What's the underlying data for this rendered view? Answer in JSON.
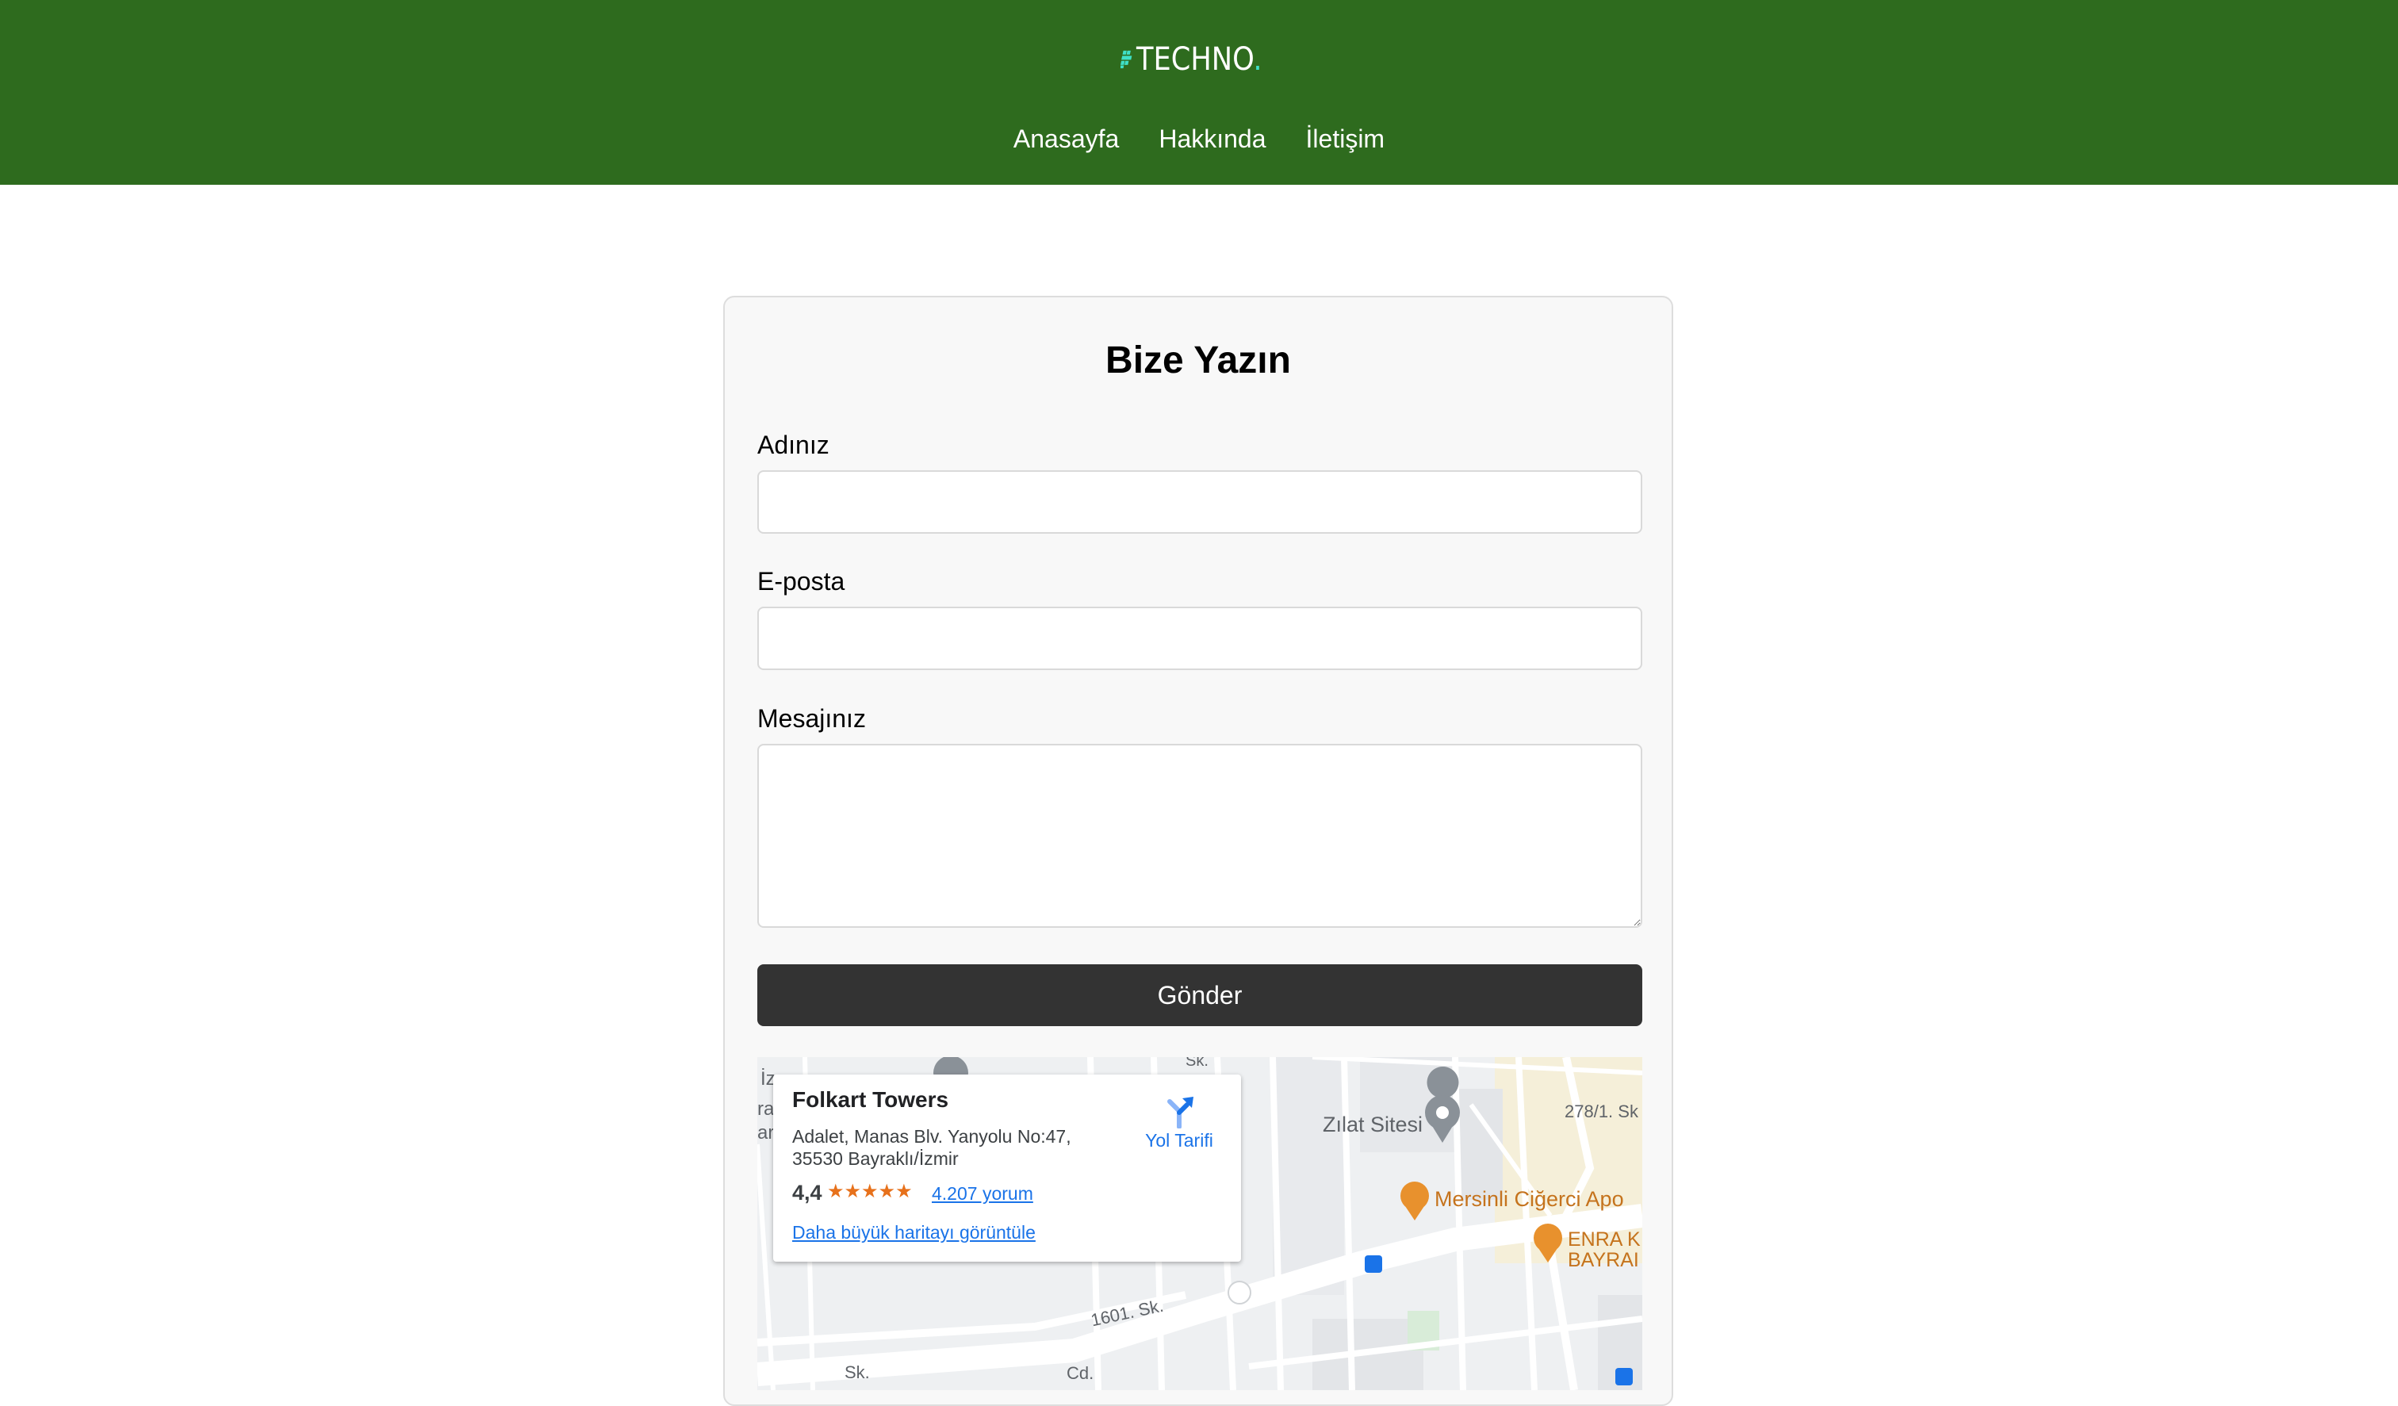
{
  "header": {
    "logo_text": "TECHNO",
    "logo_dot": ".",
    "nav": [
      "Anasayfa",
      "Hakkında",
      "İletişim"
    ]
  },
  "colors": {
    "header_bg": "#2e6b1e",
    "logo_accent": "#3fe0c8",
    "button_bg": "#333333",
    "link_blue": "#1a73e8",
    "poi_orange": "#e8912d"
  },
  "form": {
    "title": "Bize Yazın",
    "name_label": "Adınız",
    "email_label": "E-posta",
    "message_label": "Mesajınız",
    "submit_label": "Gönder"
  },
  "map": {
    "place_name": "Folkart Towers",
    "address": "Adalet, Manas Blv. Yanyolu No:47, 35530 Bayraklı/İzmir",
    "rating": "4,4",
    "stars": "★★★★★",
    "reviews": "4.207 yorum",
    "bigger_map": "Daha büyük haritayı görüntüle",
    "directions": "Yol Tarifi",
    "labels": {
      "zilat": "Zılat Sitesi",
      "mersinli": "Mersinli Ciğerci Apo",
      "enra": "ENRA K",
      "bayra": "BAYRAI",
      "street_1601": "1601. Sk.",
      "street_278": "278/1. Sk",
      "street_sk": "Sk.",
      "street_cd": "Cd.",
      "edge_iz": "İz",
      "edge_ra": "ra",
      "edge_ar": "ar",
      "top_sk": "Sk."
    }
  }
}
